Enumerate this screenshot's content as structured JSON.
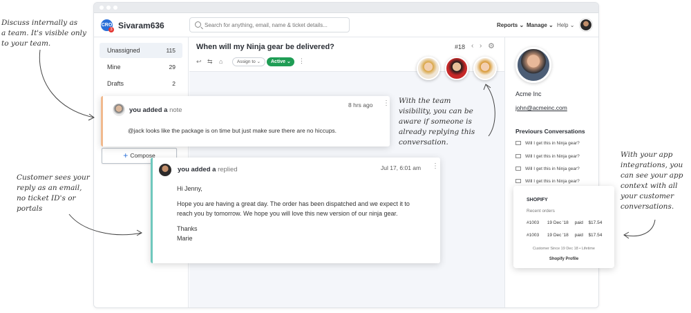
{
  "annotations": {
    "left_top": [
      "Discuss internally as",
      "a team. It's visible only",
      "to your team."
    ],
    "left_bottom": [
      "Customer sees your",
      "reply as an email,",
      "no ticket ID's or",
      "portals"
    ],
    "middle": [
      "With the team",
      "visibility, you can be",
      "aware if someone is",
      "already replying this",
      "conversation."
    ],
    "right": [
      "With your app",
      "integrations, you",
      "can see your app",
      "context with all",
      "your customer",
      "conversations."
    ]
  },
  "topbar": {
    "logo_text": "CRO",
    "logo_badge": "3",
    "brand": "Sivaram636",
    "search_placeholder": "Search for anything, email, name & ticket details...",
    "nav": {
      "reports": "Reports",
      "manage": "Manage",
      "help": "Help"
    }
  },
  "sidebar": {
    "items": [
      {
        "label": "Unassigned",
        "count": "115"
      },
      {
        "label": "Mine",
        "count": "29"
      },
      {
        "label": "Drafts",
        "count": "2"
      }
    ],
    "compose_label": "Compose"
  },
  "conversation": {
    "title": "When will my Ninja gear be delivered?",
    "ticket_no": "#18",
    "assign_label": "Assign to",
    "status_label": "Active"
  },
  "note": {
    "who": "you added a",
    "kind": "note",
    "time": "8 hrs ago",
    "text": "@jack looks like the package is on time but just make sure there are no hiccups."
  },
  "reply": {
    "who": "you added a",
    "kind": "replied",
    "time": "Jul 17, 6:01 am",
    "greeting": "Hi Jenny,",
    "body1": "Hope you are having a great day. The order has been dispatched and we expect it to",
    "body2": "reach you by tomorrow. We hope you will love this new version of our ninja gear.",
    "signoff1": "Thanks",
    "signoff2": "Marie"
  },
  "customer": {
    "name": "Acme Inc",
    "email": "john@acmeinc.com",
    "prev_title": "Previours Conversations",
    "prev_items": [
      "Will I get this in Ninja gear?",
      "Will I get this in Ninja gear?",
      "Will I get this in Ninja gear?",
      "Will I get this in Ninja gear?"
    ]
  },
  "shopify": {
    "title": "SHOPIFY",
    "subtitle": "Recent orders",
    "orders": [
      {
        "id": "#1003",
        "date": "19 Dec '18",
        "status": "paid",
        "amount": "$17.54"
      },
      {
        "id": "#1003",
        "date": "19 Dec '18",
        "status": "paid",
        "amount": "$17.54"
      }
    ],
    "footer": "Customer Since 19 Dec 18 • Lifetime",
    "link": "Shopify Profile"
  },
  "colors": {
    "brand_blue": "#2a6fd8",
    "active_green": "#1f9d55",
    "note_accent": "#f1b98d",
    "reply_accent": "#6fc8bd"
  }
}
